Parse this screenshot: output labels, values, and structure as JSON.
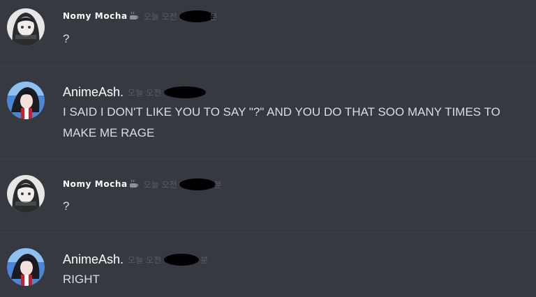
{
  "messages": [
    {
      "author": "Nomy Mocha",
      "timestamp_prefix": "오늘 오전",
      "timestamp_suffix": "분",
      "avatar_icon": "anime-avatar-dark-hair",
      "author_badge_icon": "coffee-cup-icon",
      "text": "?"
    },
    {
      "author": "AnimeAsh.",
      "timestamp_prefix": "오늘 오전",
      "timestamp_suffix": "",
      "avatar_icon": "anime-avatar-blue-hair",
      "text": "I SAID I DON'T LIKE YOU TO SAY \"?\" AND YOU DO THAT SOO MANY TIMES TO MAKE ME RAGE"
    },
    {
      "author": "Nomy Mocha",
      "timestamp_prefix": "오늘 오전",
      "timestamp_suffix": "분",
      "avatar_icon": "anime-avatar-dark-hair",
      "author_badge_icon": "coffee-cup-icon",
      "text": "?"
    },
    {
      "author": "AnimeAsh.",
      "timestamp_prefix": "오늘 오전",
      "timestamp_suffix": "분",
      "avatar_icon": "anime-avatar-blue-hair",
      "text": "RIGHT"
    }
  ],
  "colors": {
    "background": "#36393f",
    "divider": "#3f4249",
    "author": "#ffffff",
    "message_text": "#dcddde",
    "timestamp": "#5a5d63",
    "redaction": "#000000"
  }
}
